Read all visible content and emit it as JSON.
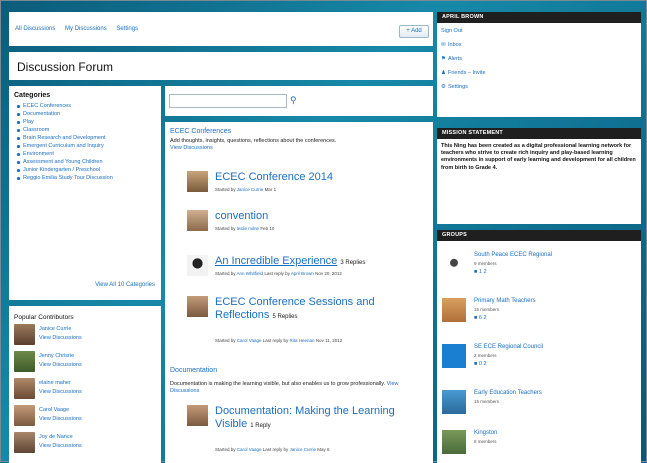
{
  "nav": {
    "links": [
      "All Discussions",
      "My Discussions",
      "Settings"
    ],
    "add_label": "+ Add"
  },
  "page_title": "Discussion Forum",
  "categories": {
    "heading": "Categories",
    "items": [
      "ECEC Conferences",
      "Documentation",
      "Play",
      "Classroom",
      "Brain Research and Development",
      "Emergent Curriculum and Inquiry",
      "Environment",
      "Assessment and Young Children",
      "Junior Kindergarten / Preschool",
      "Reggio Emilia Study Tour Discussion"
    ],
    "view_all": "View All 10 Categories"
  },
  "contributors": {
    "heading": "Popular Contributors",
    "view_label": "View Discussions",
    "people": [
      "Janice Currie",
      "Jenny Chrisrie",
      "elaine maher",
      "Carol Vaage",
      "Joy de Nance"
    ]
  },
  "search": {
    "placeholder": ""
  },
  "sections": [
    {
      "title": "ECEC Conferences",
      "description": "Add thoughts, insights, questions, reflections about the conferences.",
      "view": "View Discussions",
      "posts": [
        {
          "title": "ECEC Conference 2014",
          "replies": "",
          "meta_prefix": "Started by",
          "author": "Janice Currie",
          "date": "Mar 1"
        },
        {
          "title": "convention",
          "replies": "",
          "meta_prefix": "Started by",
          "author": "leslie milne",
          "date": "Feb 10"
        },
        {
          "title": "An Incredible Experience",
          "replies": "3 Replies",
          "meta_prefix": "Started by",
          "author": "Ann Whitfield",
          "last": "Last reply by",
          "last_author": "April Brown",
          "date": "Nov 20, 2012"
        },
        {
          "title": "ECEC Conference Sessions and Reflections",
          "replies": "5 Replies",
          "meta_prefix": "Started by",
          "author": "Carol Vaage",
          "last": "Last reply by",
          "last_author": "Rita Heenan",
          "date": "Nov 11, 2012"
        }
      ]
    },
    {
      "title": "Documentation",
      "description": "Documentation is making the learning visible, but also enables us to grow professionally.",
      "view": "View Discussions",
      "posts": [
        {
          "title": "Documentation: Making the Learning Visible",
          "replies": "1 Reply",
          "meta_prefix": "Started by",
          "author": "Carol Vaage",
          "last": "Last reply by",
          "last_author": "Janice Currie",
          "date": "May 6"
        }
      ]
    }
  ],
  "user": {
    "name": "APRIL BROWN",
    "links": [
      "Sign Out",
      "Inbox",
      "Alerts",
      "Friends – Invite",
      "Settings"
    ]
  },
  "mission": {
    "heading": "MISSION STATEMENT",
    "text": "This Ning has been created as a digital professional learning network for teachers who strive to create rich inquiry and play-based learning environments in support of early learning and development for all children from birth to Grade 4."
  },
  "groups": {
    "heading": "GROUPS",
    "items": [
      {
        "name": "South Peace ECEC Regional",
        "members": "9 members",
        "stats": "1  2"
      },
      {
        "name": "Primary Math Teachers",
        "members": "15 members",
        "stats": "6  2"
      },
      {
        "name": "SE ECE Regional Council",
        "members": "2 members",
        "stats": "0  2"
      },
      {
        "name": "Early Education Teachers",
        "members": "15 members",
        "stats": ""
      },
      {
        "name": "Kingston",
        "members": "8 members",
        "stats": ""
      }
    ]
  },
  "colors": {
    "link": "#1a6fc0",
    "header_bar": "#1f1f1f",
    "background": "#0f6f91"
  }
}
